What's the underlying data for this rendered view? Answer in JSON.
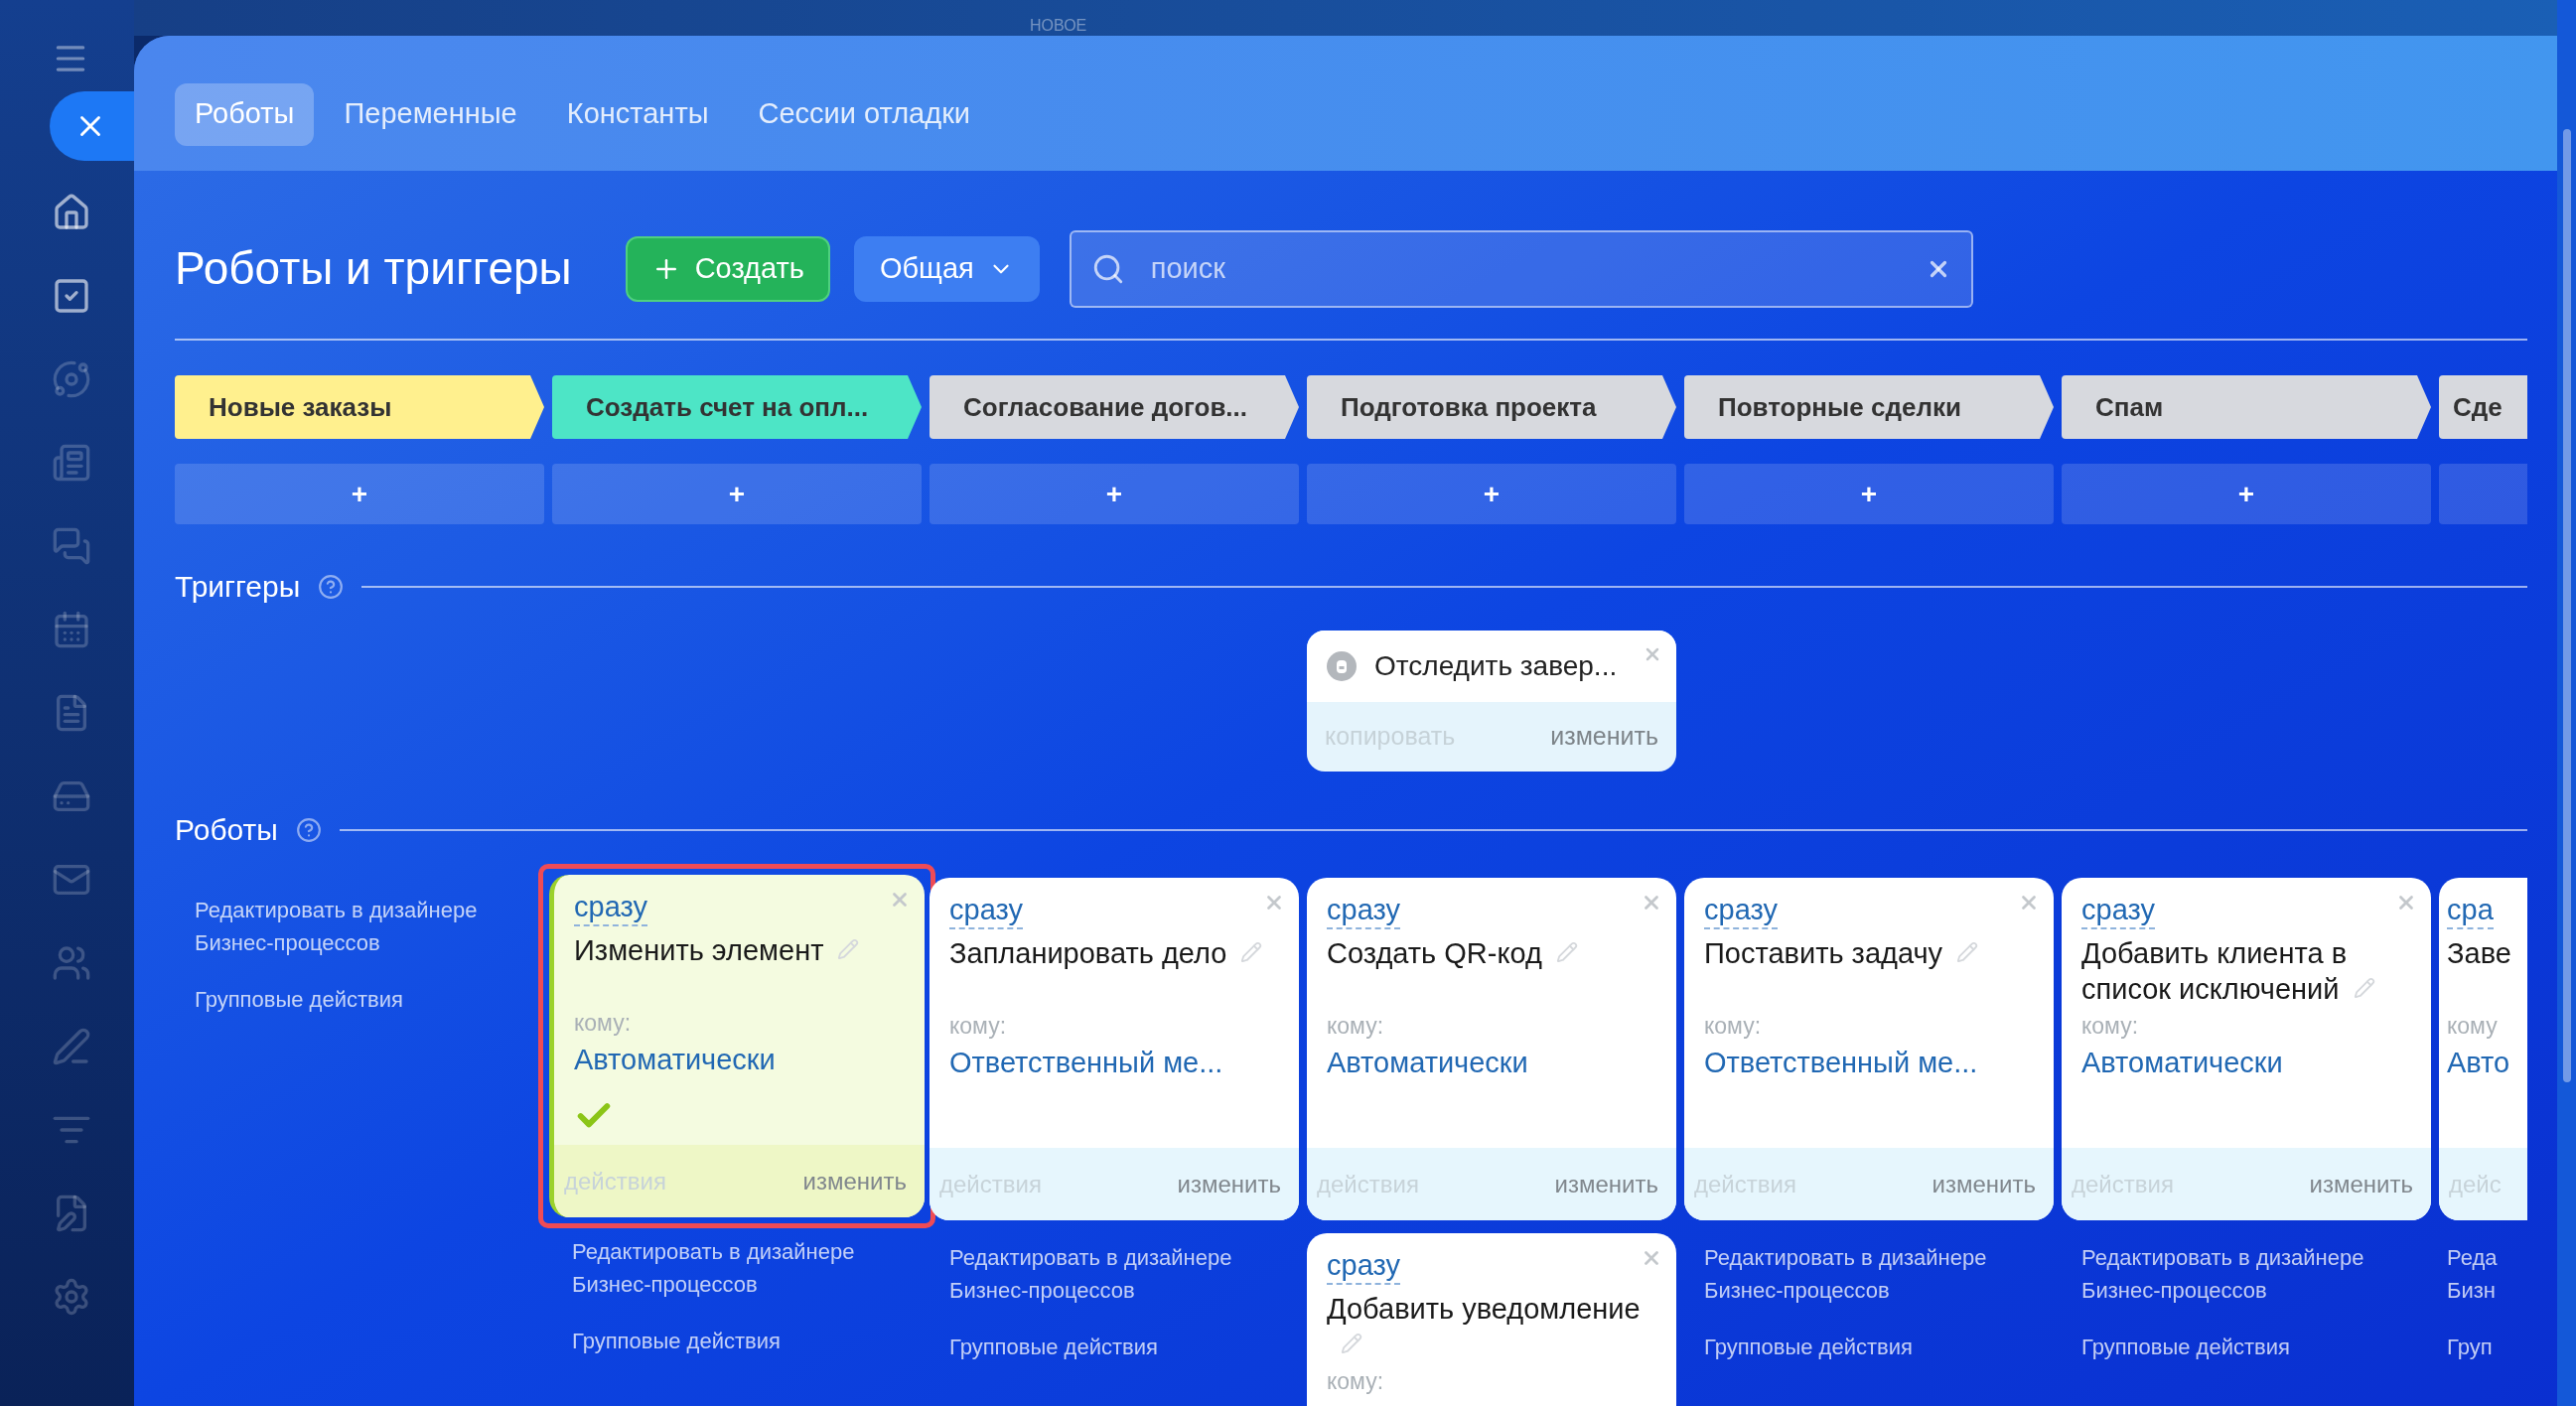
{
  "top_bar": {
    "badge": "НОВОЕ"
  },
  "tabs": [
    {
      "label": "Роботы",
      "selected": true
    },
    {
      "label": "Переменные",
      "selected": false
    },
    {
      "label": "Константы",
      "selected": false
    },
    {
      "label": "Сессии отладки",
      "selected": false
    }
  ],
  "header": {
    "title": "Роботы и триггеры",
    "create_button": "Создать",
    "filter_button": "Общая",
    "search": {
      "placeholder": "поиск"
    }
  },
  "sections": {
    "triggers": {
      "title": "Триггеры"
    },
    "robots": {
      "title": "Роботы"
    }
  },
  "stages": [
    {
      "name": "Новые заказы",
      "color": "#fff08e",
      "add": "+",
      "links": [
        "Редактировать в дизайнере Бизнес-процессов",
        "Групповые действия"
      ]
    },
    {
      "name": "Создать счет на опл...",
      "color": "#4de5c6",
      "add": "+",
      "robots": [
        {
          "timing": "сразу",
          "title": "Изменить элемент",
          "to_label": "кому:",
          "to": "Автоматически",
          "completed": true,
          "highlighted": true,
          "actions": "действия",
          "edit": "изменить"
        }
      ],
      "links": [
        "Редактировать в дизайнере Бизнес-процессов",
        "Групповые действия"
      ]
    },
    {
      "name": "Согласование догов...",
      "color": "#d7d9de",
      "add": "+",
      "robots": [
        {
          "timing": "сразу",
          "title": "Запланировать дело",
          "to_label": "кому:",
          "to": "Ответственный ме...",
          "completed": false,
          "highlighted": false,
          "actions": "действия",
          "edit": "изменить"
        }
      ],
      "links": [
        "Редактировать в дизайнере Бизнес-процессов",
        "Групповые действия"
      ]
    },
    {
      "name": "Подготовка проекта",
      "color": "#d7d9de",
      "add": "+",
      "triggers": [
        {
          "name": "Отследить завер...",
          "copy": "копировать",
          "edit": "изменить"
        }
      ],
      "robots": [
        {
          "timing": "сразу",
          "title": "Создать QR-код",
          "to_label": "кому:",
          "to": "Автоматически",
          "completed": false,
          "highlighted": false,
          "actions": "действия",
          "edit": "изменить"
        },
        {
          "timing": "сразу",
          "title": "Добавить уведомление",
          "to_label": "кому:",
          "completed": false,
          "highlighted": false
        }
      ]
    },
    {
      "name": "Повторные сделки",
      "color": "#d7d9de",
      "add": "+",
      "robots": [
        {
          "timing": "сразу",
          "title": "Поставить задачу",
          "to_label": "кому:",
          "to": "Ответственный ме...",
          "completed": false,
          "highlighted": false,
          "actions": "действия",
          "edit": "изменить"
        }
      ],
      "links": [
        "Редактировать в дизайнере Бизнес-процессов",
        "Групповые действия"
      ]
    },
    {
      "name": "Спам",
      "color": "#d7d9de",
      "add": "+",
      "robots": [
        {
          "timing": "сразу",
          "title": "Добавить клиента в список исключений",
          "to_label": "кому:",
          "to": "Автоматически",
          "completed": false,
          "highlighted": false,
          "actions": "действия",
          "edit": "изменить"
        }
      ],
      "links": [
        "Редактировать в дизайнере Бизнес-процессов",
        "Групповые действия"
      ]
    },
    {
      "name": "Сде",
      "color": "#d7d9de",
      "robots": [
        {
          "timing": "сра",
          "title": "Заве",
          "to_label": "кому",
          "to": "Авто",
          "completed": false,
          "highlighted": false,
          "actions": "дейс"
        }
      ],
      "links": [
        "Реда Бизн",
        "Груп"
      ]
    }
  ]
}
